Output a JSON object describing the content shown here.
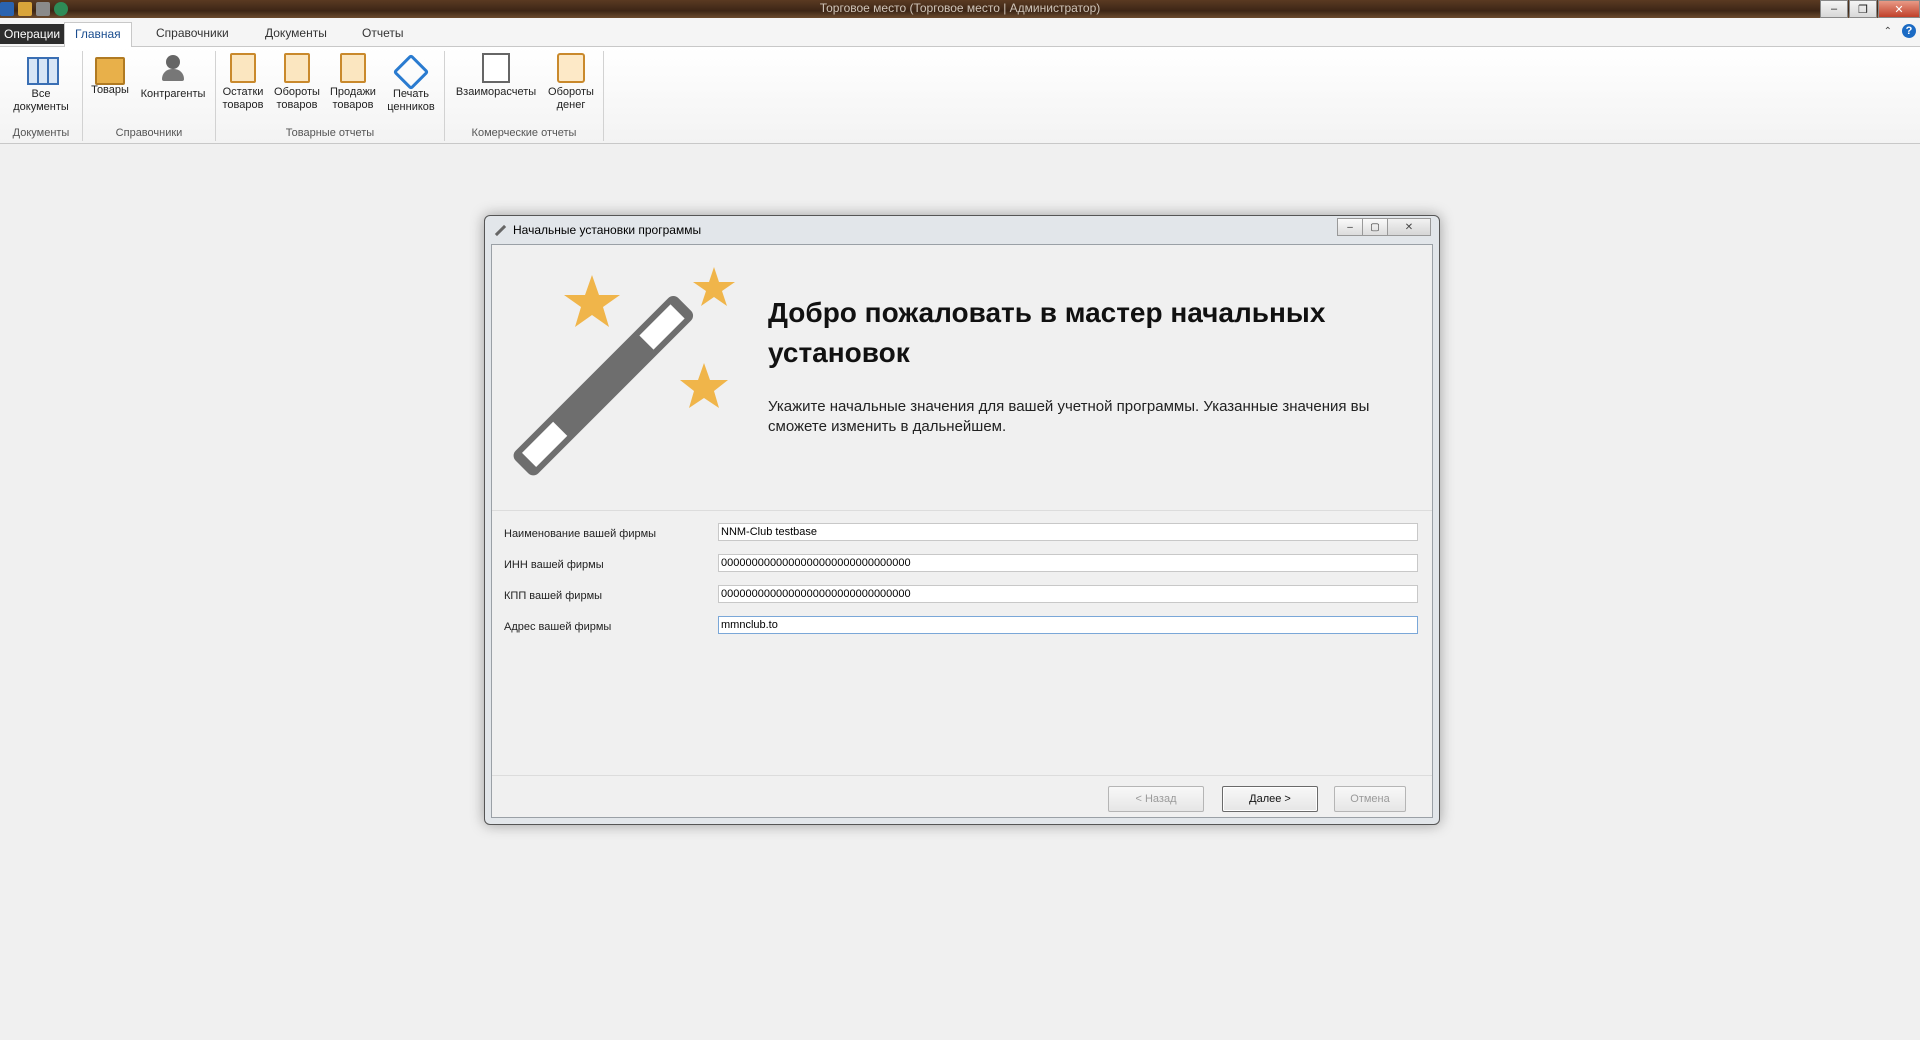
{
  "window": {
    "title": "Торговое место (Торговое место | Администратор)"
  },
  "tabs": [
    {
      "label": "Операции"
    },
    {
      "label": "Главная"
    },
    {
      "label": "Справочники"
    },
    {
      "label": "Документы"
    },
    {
      "label": "Отчеты"
    }
  ],
  "ribbon": {
    "groups": [
      {
        "caption": "Документы",
        "buttons": [
          {
            "line1": "Все",
            "line2": "документы",
            "icon": "documents-icon"
          }
        ]
      },
      {
        "caption": "Справочники",
        "buttons": [
          {
            "line1": "Товары",
            "line2": "",
            "icon": "box-icon"
          },
          {
            "line1": "Контрагенты",
            "line2": "",
            "icon": "users-icon"
          }
        ]
      },
      {
        "caption": "Товарные отчеты",
        "buttons": [
          {
            "line1": "Остатки",
            "line2": "товаров",
            "icon": "clipboard-icon"
          },
          {
            "line1": "Обороты",
            "line2": "товаров",
            "icon": "clipboard-icon"
          },
          {
            "line1": "Продажи",
            "line2": "товаров",
            "icon": "clipboard-icon"
          },
          {
            "line1": "Печать",
            "line2": "ценников",
            "icon": "price-tag-icon"
          }
        ]
      },
      {
        "caption": "Комерческие отчеты",
        "buttons": [
          {
            "line1": "Взаиморасчеты",
            "line2": "",
            "icon": "chart-icon"
          },
          {
            "line1": "Обороты",
            "line2": "денег",
            "icon": "money-icon"
          }
        ]
      }
    ]
  },
  "dialog": {
    "title": "Начальные установки программы",
    "heading": "Добро пожаловать в мастер начальных установок",
    "description": "Укажите начальные значения для вашей учетной программы. Указанные значения вы сможете изменить в дальнейшем.",
    "fields": [
      {
        "label": "Наименование вашей фирмы",
        "value": "NNM-Club testbase"
      },
      {
        "label": "ИНН вашей фирмы",
        "value": "0000000000000000000000000000000"
      },
      {
        "label": "КПП вашей фирмы",
        "value": "0000000000000000000000000000000"
      },
      {
        "label": "Адрес вашей фирмы",
        "value": "mmnclub.to"
      }
    ],
    "buttons": {
      "back": "< Назад",
      "next": "Далее >",
      "cancel": "Отмена"
    }
  },
  "colors": {
    "star": "#f0b54a",
    "wand": "#6e6e6e",
    "active_tab_text": "#1a4d8f"
  }
}
